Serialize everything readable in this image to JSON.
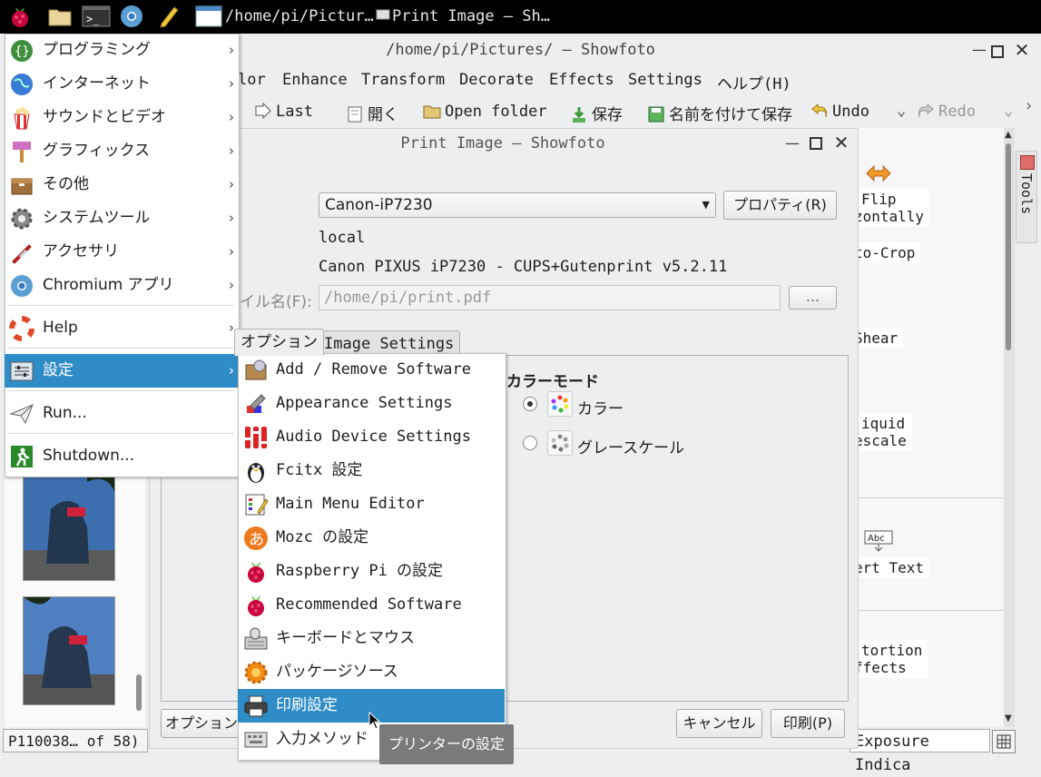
{
  "taskbar": {
    "tasks": [
      {
        "label": "/home/pi/Pictur…"
      },
      {
        "label": "Print Image — Sh…"
      }
    ]
  },
  "main_window": {
    "title": "/home/pi/Pictures/ — Showfoto",
    "menu": [
      "lor",
      "Enhance",
      "Transform",
      "Decorate",
      "Effects",
      "Settings",
      "ヘルプ(H)"
    ],
    "toolbar": {
      "last": "Last",
      "open": "開く",
      "open_folder": "Open folder",
      "save": "保存",
      "save_as": "名前を付けて保存",
      "undo": "Undo",
      "redo": "Redo"
    },
    "tools": [
      "Flip",
      "zontally",
      "to-Crop",
      "Shear",
      "iquid",
      "escale",
      "ert Text",
      "tortion",
      "ffects"
    ],
    "tools_tab": "Tools",
    "status_left": "P110038… of 58)",
    "status_right": "Exposure Indica"
  },
  "dialog": {
    "title": "Print Image — Showfoto",
    "printer": "Canon-iP7230",
    "properties": "プロパティ(R)",
    "location": "local",
    "description": "Canon PIXUS iP7230 - CUPS+Gutenprint v5.2.11",
    "file_label": "イル名(F):",
    "file_path": "/home/pi/print.pdf",
    "browse": "...",
    "tabs": [
      "オプション",
      "Image Settings"
    ],
    "color_mode_title": "カラーモード",
    "color_options": [
      "カラー",
      "グレースケール"
    ],
    "options_button": "オプション",
    "cancel": "キャンセル",
    "print": "印刷(P)"
  },
  "app_menu": [
    {
      "label": "プログラミング",
      "icon": "braces-icon"
    },
    {
      "label": "インターネット",
      "icon": "globe-icon"
    },
    {
      "label": "サウンドとビデオ",
      "icon": "popcorn-icon"
    },
    {
      "label": "グラフィックス",
      "icon": "paint-icon"
    },
    {
      "label": "その他",
      "icon": "box-icon"
    },
    {
      "label": "システムツール",
      "icon": "gear-icon"
    },
    {
      "label": "アクセサリ",
      "icon": "knife-icon"
    },
    {
      "label": "Chromium アプリ",
      "icon": "chromium-icon"
    },
    {
      "label": "Help",
      "icon": "lifebuoy-icon"
    },
    {
      "label": "設定",
      "icon": "settings-icon"
    },
    {
      "label": "Run...",
      "icon": "paper-plane-icon"
    },
    {
      "label": "Shutdown...",
      "icon": "exit-icon"
    }
  ],
  "settings_menu": [
    {
      "label": "Add / Remove Software"
    },
    {
      "label": "Appearance Settings"
    },
    {
      "label": "Audio Device Settings"
    },
    {
      "label": "Fcitx 設定"
    },
    {
      "label": "Main Menu Editor"
    },
    {
      "label": "Mozc の設定"
    },
    {
      "label": "Raspberry Pi の設定"
    },
    {
      "label": "Recommended Software"
    },
    {
      "label": "キーボードとマウス"
    },
    {
      "label": "パッケージソース"
    },
    {
      "label": "印刷設定"
    },
    {
      "label": "入力メソッド"
    }
  ],
  "tooltip": "プリンターの設定",
  "colors": {
    "accent": "#308cc6",
    "panel": "#000000"
  }
}
